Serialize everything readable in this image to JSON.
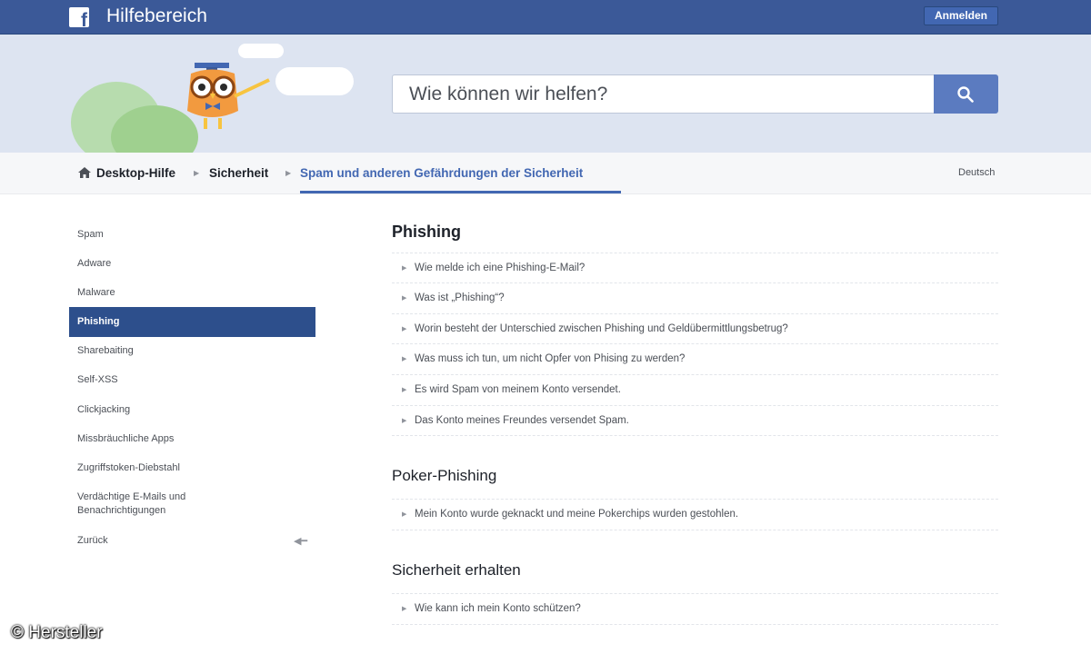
{
  "header": {
    "logo_letter": "f",
    "title": "Hilfebereich",
    "login_label": "Anmelden"
  },
  "search": {
    "placeholder": "Wie können wir helfen?",
    "icon": "search-icon"
  },
  "breadcrumb": {
    "items": [
      "Desktop-Hilfe",
      "Sicherheit",
      "Spam und anderen Gefährdungen der Sicherheit"
    ],
    "language": "Deutsch"
  },
  "sidebar": {
    "items": [
      "Spam",
      "Adware",
      "Malware",
      "Phishing",
      "Sharebaiting",
      "Self-XSS",
      "Clickjacking",
      "Missbräuchliche Apps",
      "Zugriffstoken-Diebstahl",
      "Verdächtige E-Mails und",
      "Benachrichtigungen",
      "Zurück"
    ],
    "active": "Phishing"
  },
  "sections": [
    {
      "title": "Phishing",
      "questions": [
        "Wie melde ich eine Phishing-E-Mail?",
        "Was ist „Phishing“?",
        "Worin besteht der Unterschied zwischen Phishing und Geldübermittlungsbetrug?",
        "Was muss ich tun, um nicht Opfer von Phising zu werden?",
        "Es wird Spam von meinem Konto versendet.",
        "Das Konto meines Freundes versendet Spam."
      ]
    },
    {
      "title": "Poker-Phishing",
      "questions": [
        "Mein Konto wurde geknackt und meine Pokerchips wurden gestohlen."
      ]
    },
    {
      "title": "Sicherheit erhalten",
      "questions": [
        "Wie kann ich mein Konto schützen?"
      ]
    }
  ],
  "watermark": "© Hersteller",
  "colors": {
    "brand_blue": "#3b5998",
    "active_blue": "#2d4f8c",
    "link_blue": "#4267b2",
    "hero_bg": "#dde4f1"
  }
}
